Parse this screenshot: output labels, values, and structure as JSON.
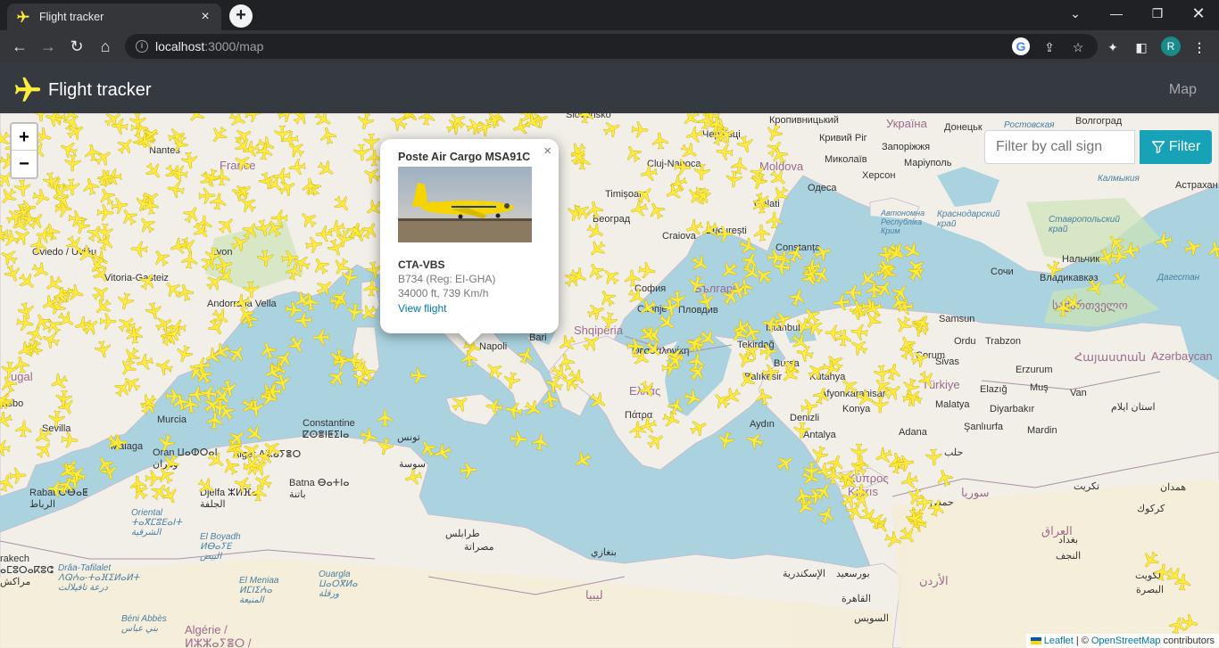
{
  "browser": {
    "tab_title": "Flight tracker",
    "url_host": "localhost",
    "url_path": ":3000/map",
    "profile_initial": "R"
  },
  "app": {
    "brand": "Flight tracker",
    "nav_map": "Map",
    "accent": "#17a2b8",
    "plane_color": "#ffeb3b"
  },
  "filter": {
    "placeholder": "Filter by call sign",
    "button_label": "Filter"
  },
  "map": {
    "zoom_in": "+",
    "zoom_out": "−",
    "labels": {
      "lyon": "Lyon",
      "nantes": "Nantes",
      "france": "France",
      "oviedo": "Oviedo / Uviéu",
      "vitoria": "Vitoria-Gasteiz",
      "andorra": "Andorra la Vella",
      "portugal": "ugal",
      "lisboa": "Lisbo",
      "murcia": "Murcia",
      "sevilla": "Sevilla",
      "malaga": "Málaga",
      "rabat": "Rabat ⵔⴱⴰⵟ\nالرباط",
      "oran": "Oran ⵡⴰⵀⵔⴰⵏ\nوهران",
      "alger": "Alger ⴷⵣⴰⵢⴻⵔ",
      "constantine": "Constantine\nⵇⵙⴻⵏⵟⵉⵏⴰ",
      "tunis": "تونس",
      "sousse": "سوسة",
      "batna": "Batna ⴱⴰⵜⵏⴰ\nباتنة",
      "djelfa": "Djelfa ⵣⵍⴼⴰ\nالجلفة",
      "napoli": "Napoli",
      "bari": "Bari",
      "shqiperia": "Shqipëria",
      "sofia": "София",
      "skopje": "Скопје",
      "plovdiv": "Пловдив",
      "bulgaria": "България",
      "beograd": "Београд",
      "craiova": "Craiova",
      "bucuresti": "București",
      "constanta": "Constanța",
      "galati": "Galati",
      "moldova": "Moldova",
      "odesa": "Одеса",
      "kherson": "Херсон",
      "mykolaiv": "Миколаїв",
      "zaporizhzhia": "Запоріжжя",
      "kryvyi": "Кривий Ріг",
      "ukraina": "Україна",
      "donetsk": "Донецьк",
      "rostov": "Ростовская\nобласть",
      "volgograd": "Волгоград",
      "krasnodar": "Краснодарский\nкрай",
      "stavropol": "Ставропольский\nкрай",
      "astrakhan": "Астрахан",
      "kalmykia": "Калмыкия",
      "nalchik": "Нальчик",
      "vladikavkaz": "Владикавказ",
      "sochi": "Сочи",
      "dagestan": "Дагестан",
      "georgia": "საქართველო",
      "armenia": "Հայաստան",
      "azerbaycan": "Azərbaycan",
      "samsun": "Samsun",
      "ordu": "Ordu",
      "trabzon": "Trabzon",
      "erzurum": "Erzurum",
      "sivas": "Sivas",
      "corum": "Çorum",
      "istanbul": "İstanbul",
      "tekirdag": "Tekirdağ",
      "bursa": "Bursa",
      "balikesir": "Balıkesir",
      "kutahya": "Kütahya",
      "afyon": "Afyonkarahisar",
      "konya": "Konya",
      "turkiye": "Türkiye",
      "aydin": "Aydın",
      "denizli": "Denizli",
      "antalya": "Antalya",
      "adana": "Adana",
      "malatya": "Malatya",
      "elazig": "Elazığ",
      "mus": "Muş",
      "van": "Van",
      "diyarbakir": "Diyarbakır",
      "sanliurfa": "Şanlıurfa",
      "mardin": "Mardin",
      "thessaloniki": "Θεσσαλονίκη",
      "ellada": "Ελλάς",
      "patra": "Πάτρα",
      "kypros": "Κύπρος\nKıbrıs",
      "halab": "حلب",
      "suriya": "سوريا",
      "homs": "حمص",
      "iraq": "العراق",
      "baghdad": "بغداد",
      "kuwait": "الكويت",
      "najaf": "النجف",
      "tarabulus": "طرابلس",
      "misrata": "مصراتة",
      "benghazi": "بنغازي",
      "libya": "ليبيا",
      "alexandria": "الإسكندرية",
      "cairo": "القاهرة",
      "suez": "السويس",
      "portsaid": "بورسعيد",
      "jordan": "الأردن",
      "marrakech": "rakech\nⴰⵎⵓⵔⴰⴽⵓⵛ\nمراكش",
      "draa": "Drâa-Tafilalet\nⴷⵕⵄⴰ-ⵜⴰⴼⵉⵍⴰⵍⵜ\nدرعة تافيلالت",
      "oriental": "Oriental\nⵜⴰⴳⵎⵓⴹⴰⵏⵜ\nالشرقية",
      "elbayadh": "El Boyadh\nⵍⴱⴰⵢⴹ\nالبيض",
      "ouargla": "Ouargla\nⵡⴰⵔⴳⵍⴰ\nورقلة",
      "elmeniaa": "El Meniaa\nⵍⵎⵏⵉⵄⴰ\nالمنيعة",
      "algerie": "Algérie /\nⵍⵣⵣⴰⵢⴻⵔ /",
      "beniabbes": "Béni Abbès\nبني عباس",
      "krim": "Автономна\nРеспубліка\nКрим",
      "slovensko": "Slovensko",
      "chernivtsi": "Чернівці",
      "kropyvnytskyi": "Кропивницький",
      "mariupol": "Маріуполь",
      "cluj": "Cluj-Napoca",
      "timisoara": "Timișoara",
      "kirkuk": "كركوك",
      "hamdan": "همدان",
      "basra": "البصرة",
      "ilam": "استان ایلام",
      "tikrit": "تكريت"
    }
  },
  "popup": {
    "title": "Poste Air Cargo MSA91C",
    "registration_code": "CTA-VBS",
    "aircraft": "B734 (Reg: EI-GHA)",
    "altitude_speed": "34000 ft, 739 Km/h",
    "link": "View flight",
    "close": "×"
  },
  "attribution": {
    "leaflet": "Leaflet",
    "separator": "| ©",
    "osm": "OpenStreetMap",
    "contributors": "contributors"
  }
}
